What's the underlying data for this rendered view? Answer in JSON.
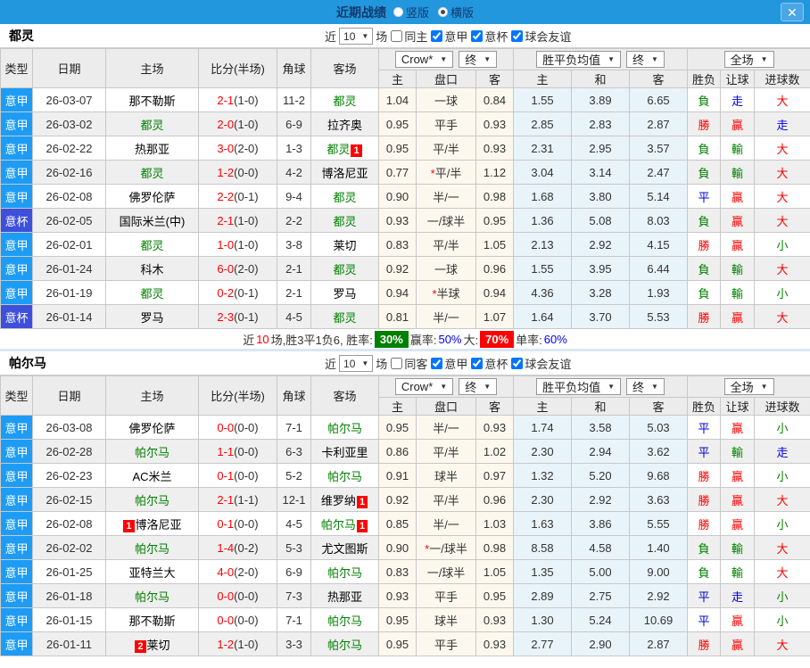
{
  "titlebar": {
    "title": "近期战绩",
    "radios": [
      {
        "label": "竖版",
        "checked": false
      },
      {
        "label": "横版",
        "checked": true
      }
    ],
    "close_label": "✕"
  },
  "columns": {
    "left": [
      "类型",
      "日期",
      "主场",
      "比分(半场)",
      "角球",
      "客场"
    ],
    "sub": [
      "主",
      "盘口",
      "客",
      "主",
      "和",
      "客",
      "胜负",
      "让球",
      "进球数"
    ]
  },
  "sections": [
    {
      "team": "都灵",
      "filter": {
        "label_near": "近",
        "count": "10",
        "label_games": "场",
        "checkboxes": [
          {
            "label": "同主",
            "checked": false
          },
          {
            "label": "意甲",
            "checked": true
          },
          {
            "label": "意杯",
            "checked": true
          },
          {
            "label": "球会友谊",
            "checked": true
          }
        ]
      },
      "dropdowns": {
        "group1": [
          "Crow*",
          "终"
        ],
        "group2": [
          "胜平负均值",
          "终"
        ],
        "group3": [
          "全场"
        ]
      },
      "rows": [
        {
          "league": "意甲",
          "date": "26-03-07",
          "home": "那不勒斯",
          "home_team": false,
          "score": "2-1",
          "half": "(1-0)",
          "corner": "11-2",
          "away": "都灵",
          "away_team": true,
          "odds_home": "1.04",
          "handicap": "一球",
          "star": false,
          "odds_away": "0.84",
          "avg_home": "1.55",
          "avg_draw": "3.89",
          "avg_away": "6.65",
          "result": "負",
          "let_ball": "走",
          "goals": "大"
        },
        {
          "league": "意甲",
          "date": "26-03-02",
          "home": "都灵",
          "home_team": true,
          "score": "2-0",
          "half": "(1-0)",
          "corner": "6-9",
          "away": "拉齐奥",
          "away_team": false,
          "odds_home": "0.95",
          "handicap": "平手",
          "star": false,
          "odds_away": "0.93",
          "avg_home": "2.85",
          "avg_draw": "2.83",
          "avg_away": "2.87",
          "result": "勝",
          "let_ball": "贏",
          "goals": "走"
        },
        {
          "league": "意甲",
          "date": "26-02-22",
          "home": "热那亚",
          "home_team": false,
          "score": "3-0",
          "half": "(2-0)",
          "corner": "1-3",
          "away": "都灵",
          "away_team": true,
          "away_badge": "1",
          "odds_home": "0.95",
          "handicap": "平/半",
          "star": false,
          "odds_away": "0.93",
          "avg_home": "2.31",
          "avg_draw": "2.95",
          "avg_away": "3.57",
          "result": "負",
          "let_ball": "輸",
          "goals": "大"
        },
        {
          "league": "意甲",
          "date": "26-02-16",
          "home": "都灵",
          "home_team": true,
          "score": "1-2",
          "half": "(0-0)",
          "corner": "4-2",
          "away": "博洛尼亚",
          "away_team": false,
          "odds_home": "0.77",
          "handicap": "平/半",
          "star": true,
          "odds_away": "1.12",
          "avg_home": "3.04",
          "avg_draw": "3.14",
          "avg_away": "2.47",
          "result": "負",
          "let_ball": "輸",
          "goals": "大"
        },
        {
          "league": "意甲",
          "date": "26-02-08",
          "home": "佛罗伦萨",
          "home_team": false,
          "score": "2-2",
          "half": "(0-1)",
          "corner": "9-4",
          "away": "都灵",
          "away_team": true,
          "odds_home": "0.90",
          "handicap": "半/一",
          "star": false,
          "odds_away": "0.98",
          "avg_home": "1.68",
          "avg_draw": "3.80",
          "avg_away": "5.14",
          "result": "平",
          "let_ball": "贏",
          "goals": "大"
        },
        {
          "league": "意杯",
          "date": "26-02-05",
          "home": "国际米兰(中)",
          "home_team": false,
          "score": "2-1",
          "half": "(1-0)",
          "corner": "2-2",
          "away": "都灵",
          "away_team": true,
          "odds_home": "0.93",
          "handicap": "一/球半",
          "star": false,
          "odds_away": "0.95",
          "avg_home": "1.36",
          "avg_draw": "5.08",
          "avg_away": "8.03",
          "result": "負",
          "let_ball": "贏",
          "goals": "大"
        },
        {
          "league": "意甲",
          "date": "26-02-01",
          "home": "都灵",
          "home_team": true,
          "score": "1-0",
          "half": "(1-0)",
          "corner": "3-8",
          "away": "莱切",
          "away_team": false,
          "odds_home": "0.83",
          "handicap": "平/半",
          "star": false,
          "odds_away": "1.05",
          "avg_home": "2.13",
          "avg_draw": "2.92",
          "avg_away": "4.15",
          "result": "勝",
          "let_ball": "贏",
          "goals": "小"
        },
        {
          "league": "意甲",
          "date": "26-01-24",
          "home": "科木",
          "home_team": false,
          "score": "6-0",
          "half": "(2-0)",
          "corner": "2-1",
          "away": "都灵",
          "away_team": true,
          "odds_home": "0.92",
          "handicap": "一球",
          "star": false,
          "odds_away": "0.96",
          "avg_home": "1.55",
          "avg_draw": "3.95",
          "avg_away": "6.44",
          "result": "負",
          "let_ball": "輸",
          "goals": "大"
        },
        {
          "league": "意甲",
          "date": "26-01-19",
          "home": "都灵",
          "home_team": true,
          "score": "0-2",
          "half": "(0-1)",
          "corner": "2-1",
          "away": "罗马",
          "away_team": false,
          "odds_home": "0.94",
          "handicap": "半球",
          "star": true,
          "odds_away": "0.94",
          "avg_home": "4.36",
          "avg_draw": "3.28",
          "avg_away": "1.93",
          "result": "負",
          "let_ball": "輸",
          "goals": "小"
        },
        {
          "league": "意杯",
          "date": "26-01-14",
          "home": "罗马",
          "home_team": false,
          "score": "2-3",
          "half": "(0-1)",
          "corner": "4-5",
          "away": "都灵",
          "away_team": true,
          "odds_home": "0.81",
          "handicap": "半/一",
          "star": false,
          "odds_away": "1.07",
          "avg_home": "1.64",
          "avg_draw": "3.70",
          "avg_away": "5.53",
          "result": "勝",
          "let_ball": "贏",
          "goals": "大"
        }
      ],
      "summary": [
        {
          "t": "近"
        },
        {
          "t": "10",
          "s": "red"
        },
        {
          "t": "场,胜3平1负6, 胜率:"
        },
        {
          "t": "30%",
          "s": "green-badge"
        },
        {
          "t": " 赢率:"
        },
        {
          "t": "50%",
          "s": "blue"
        },
        {
          "t": " 大:"
        },
        {
          "t": "70%",
          "s": "red-badge"
        },
        {
          "t": " 单率:"
        },
        {
          "t": "60%",
          "s": "blue"
        }
      ]
    },
    {
      "team": "帕尔马",
      "filter": {
        "label_near": "近",
        "count": "10",
        "label_games": "场",
        "checkboxes": [
          {
            "label": "同客",
            "checked": false
          },
          {
            "label": "意甲",
            "checked": true
          },
          {
            "label": "意杯",
            "checked": true
          },
          {
            "label": "球会友谊",
            "checked": true
          }
        ]
      },
      "dropdowns": {
        "group1": [
          "Crow*",
          "终"
        ],
        "group2": [
          "胜平负均值",
          "终"
        ],
        "group3": [
          "全场"
        ]
      },
      "rows": [
        {
          "league": "意甲",
          "date": "26-03-08",
          "home": "佛罗伦萨",
          "home_team": false,
          "score": "0-0",
          "half": "(0-0)",
          "corner": "7-1",
          "away": "帕尔马",
          "away_team": true,
          "odds_home": "0.95",
          "handicap": "半/一",
          "star": false,
          "odds_away": "0.93",
          "avg_home": "1.74",
          "avg_draw": "3.58",
          "avg_away": "5.03",
          "result": "平",
          "let_ball": "贏",
          "goals": "小"
        },
        {
          "league": "意甲",
          "date": "26-02-28",
          "home": "帕尔马",
          "home_team": true,
          "score": "1-1",
          "half": "(0-0)",
          "corner": "6-3",
          "away": "卡利亚里",
          "away_team": false,
          "odds_home": "0.86",
          "handicap": "平/半",
          "star": false,
          "odds_away": "1.02",
          "avg_home": "2.30",
          "avg_draw": "2.94",
          "avg_away": "3.62",
          "result": "平",
          "let_ball": "輸",
          "goals": "走"
        },
        {
          "league": "意甲",
          "date": "26-02-23",
          "home": "AC米兰",
          "home_team": false,
          "score": "0-1",
          "half": "(0-0)",
          "corner": "5-2",
          "away": "帕尔马",
          "away_team": true,
          "odds_home": "0.91",
          "handicap": "球半",
          "star": false,
          "odds_away": "0.97",
          "avg_home": "1.32",
          "avg_draw": "5.20",
          "avg_away": "9.68",
          "result": "勝",
          "let_ball": "贏",
          "goals": "小"
        },
        {
          "league": "意甲",
          "date": "26-02-15",
          "home": "帕尔马",
          "home_team": true,
          "score": "2-1",
          "half": "(1-1)",
          "corner": "12-1",
          "away": "维罗纳",
          "away_team": false,
          "away_badge": "1",
          "odds_home": "0.92",
          "handicap": "平/半",
          "star": false,
          "odds_away": "0.96",
          "avg_home": "2.30",
          "avg_draw": "2.92",
          "avg_away": "3.63",
          "result": "勝",
          "let_ball": "贏",
          "goals": "大"
        },
        {
          "league": "意甲",
          "date": "26-02-08",
          "home": "博洛尼亚",
          "home_team": false,
          "home_badge": "1",
          "score": "0-1",
          "half": "(0-0)",
          "corner": "4-5",
          "away": "帕尔马",
          "away_team": true,
          "away_badge": "1",
          "odds_home": "0.85",
          "handicap": "半/一",
          "star": false,
          "odds_away": "1.03",
          "avg_home": "1.63",
          "avg_draw": "3.86",
          "avg_away": "5.55",
          "result": "勝",
          "let_ball": "贏",
          "goals": "小"
        },
        {
          "league": "意甲",
          "date": "26-02-02",
          "home": "帕尔马",
          "home_team": true,
          "score": "1-4",
          "half": "(0-2)",
          "corner": "5-3",
          "away": "尤文图斯",
          "away_team": false,
          "odds_home": "0.90",
          "handicap": "一/球半",
          "star": true,
          "odds_away": "0.98",
          "avg_home": "8.58",
          "avg_draw": "4.58",
          "avg_away": "1.40",
          "result": "負",
          "let_ball": "輸",
          "goals": "大"
        },
        {
          "league": "意甲",
          "date": "26-01-25",
          "home": "亚特兰大",
          "home_team": false,
          "score": "4-0",
          "half": "(2-0)",
          "corner": "6-9",
          "away": "帕尔马",
          "away_team": true,
          "odds_home": "0.83",
          "handicap": "一/球半",
          "star": false,
          "odds_away": "1.05",
          "avg_home": "1.35",
          "avg_draw": "5.00",
          "avg_away": "9.00",
          "result": "負",
          "let_ball": "輸",
          "goals": "大"
        },
        {
          "league": "意甲",
          "date": "26-01-18",
          "home": "帕尔马",
          "home_team": true,
          "score": "0-0",
          "half": "(0-0)",
          "corner": "7-3",
          "away": "热那亚",
          "away_team": false,
          "odds_home": "0.93",
          "handicap": "平手",
          "star": false,
          "odds_away": "0.95",
          "avg_home": "2.89",
          "avg_draw": "2.75",
          "avg_away": "2.92",
          "result": "平",
          "let_ball": "走",
          "goals": "小"
        },
        {
          "league": "意甲",
          "date": "26-01-15",
          "home": "那不勒斯",
          "home_team": false,
          "score": "0-0",
          "half": "(0-0)",
          "corner": "7-1",
          "away": "帕尔马",
          "away_team": true,
          "odds_home": "0.95",
          "handicap": "球半",
          "star": false,
          "odds_away": "0.93",
          "avg_home": "1.30",
          "avg_draw": "5.24",
          "avg_away": "10.69",
          "result": "平",
          "let_ball": "贏",
          "goals": "小"
        },
        {
          "league": "意甲",
          "date": "26-01-11",
          "home": "莱切",
          "home_team": false,
          "home_badge": "2",
          "score": "1-2",
          "half": "(1-0)",
          "corner": "3-3",
          "away": "帕尔马",
          "away_team": true,
          "odds_home": "0.95",
          "handicap": "平手",
          "star": false,
          "odds_away": "0.93",
          "avg_home": "2.77",
          "avg_draw": "2.90",
          "avg_away": "2.87",
          "result": "勝",
          "let_ball": "贏",
          "goals": "大"
        }
      ],
      "summary": null
    }
  ]
}
